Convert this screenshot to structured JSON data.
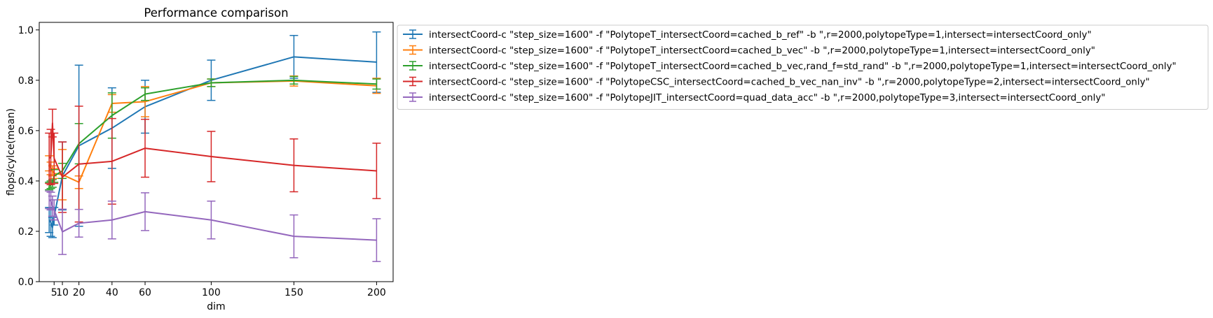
{
  "chart_data": {
    "type": "line",
    "title": "Performance comparison",
    "xlabel": "dim",
    "ylabel": "flops/cylce(mean)",
    "xlim": [
      -4,
      210
    ],
    "ylim": [
      0,
      1.03
    ],
    "xticks": [
      5,
      10,
      20,
      40,
      60,
      100,
      150,
      200
    ],
    "xtick_labels": [
      "5",
      "10",
      "20",
      "40",
      "60",
      "100",
      "150",
      "200"
    ],
    "yticks": [
      0.0,
      0.2,
      0.4,
      0.6,
      0.8,
      1.0
    ],
    "ytick_labels": [
      "0.0",
      "0.2",
      "0.4",
      "0.6",
      "0.8",
      "1.0"
    ],
    "grid": false,
    "error_bars": true,
    "legend_placement": "outside upper-right of plot",
    "x": [
      2,
      3,
      4,
      5,
      10,
      20,
      40,
      60,
      100,
      150,
      200
    ],
    "series": [
      {
        "name": "intersectCoord-c \"step_size=1600\" -f \"PolytopeT_intersectCoord=cached_b_ref\" -b \",r=2000,polytopeType=1,intersect=intersectCoord_only\"",
        "color": "#1f77b4",
        "values": [
          0.245,
          0.235,
          0.215,
          0.26,
          0.42,
          0.54,
          0.61,
          0.695,
          0.8,
          0.893,
          0.872
        ],
        "err": [
          0.05,
          0.055,
          0.04,
          0.035,
          0.135,
          0.32,
          0.16,
          0.105,
          0.08,
          0.085,
          0.12
        ]
      },
      {
        "name": "intersectCoord-c \"step_size=1600\" -f \"PolytopeT_intersectCoord=cached_b_vec\" -b \",r=2000,polytopeType=1,intersect=intersectCoord_only\"",
        "color": "#ff7f0e",
        "values": [
          0.47,
          0.45,
          0.44,
          0.43,
          0.425,
          0.395,
          0.708,
          0.715,
          0.79,
          0.797,
          0.778
        ],
        "err": [
          0.03,
          0.025,
          0.02,
          0.02,
          0.1,
          0.025,
          0.035,
          0.06,
          0.015,
          0.02,
          0.03
        ]
      },
      {
        "name": "intersectCoord-c \"step_size=1600\" -f \"PolytopeT_intersectCoord=cached_b_vec,rand_f=std_rand\" -b \",r=2000,polytopeType=1,intersect=intersectCoord_only\"",
        "color": "#2ca02c",
        "values": [
          0.38,
          0.385,
          0.39,
          0.42,
          0.44,
          0.548,
          0.66,
          0.745,
          0.79,
          0.8,
          0.785
        ],
        "err": [
          0.015,
          0.015,
          0.015,
          0.025,
          0.03,
          0.08,
          0.09,
          0.025,
          0.015,
          0.015,
          0.02
        ]
      },
      {
        "name": "intersectCoord-c \"step_size=1600\" -f \"PolytopeCSC_intersectCoord=cached_b_vec_nan_inv\" -b \",r=2000,polytopeType=2,intersect=intersectCoord_only\"",
        "color": "#d62728",
        "values": [
          0.49,
          0.495,
          0.63,
          0.49,
          0.415,
          0.467,
          0.478,
          0.53,
          0.497,
          0.462,
          0.44
        ],
        "err": [
          0.1,
          0.11,
          0.055,
          0.1,
          0.14,
          0.23,
          0.17,
          0.115,
          0.1,
          0.105,
          0.11
        ]
      },
      {
        "name": "intersectCoord-c \"step_size=1600\" -f \"PolytopeJIT_intersectCoord=quad_data_acc\" -b \",r=2000,polytopeType=3,intersect=intersectCoord_only\"",
        "color": "#9467bd",
        "values": [
          0.325,
          0.32,
          0.3,
          0.285,
          0.198,
          0.232,
          0.245,
          0.278,
          0.245,
          0.18,
          0.165
        ],
        "err": [
          0.035,
          0.035,
          0.04,
          0.04,
          0.09,
          0.055,
          0.075,
          0.075,
          0.075,
          0.085,
          0.085
        ]
      }
    ]
  }
}
